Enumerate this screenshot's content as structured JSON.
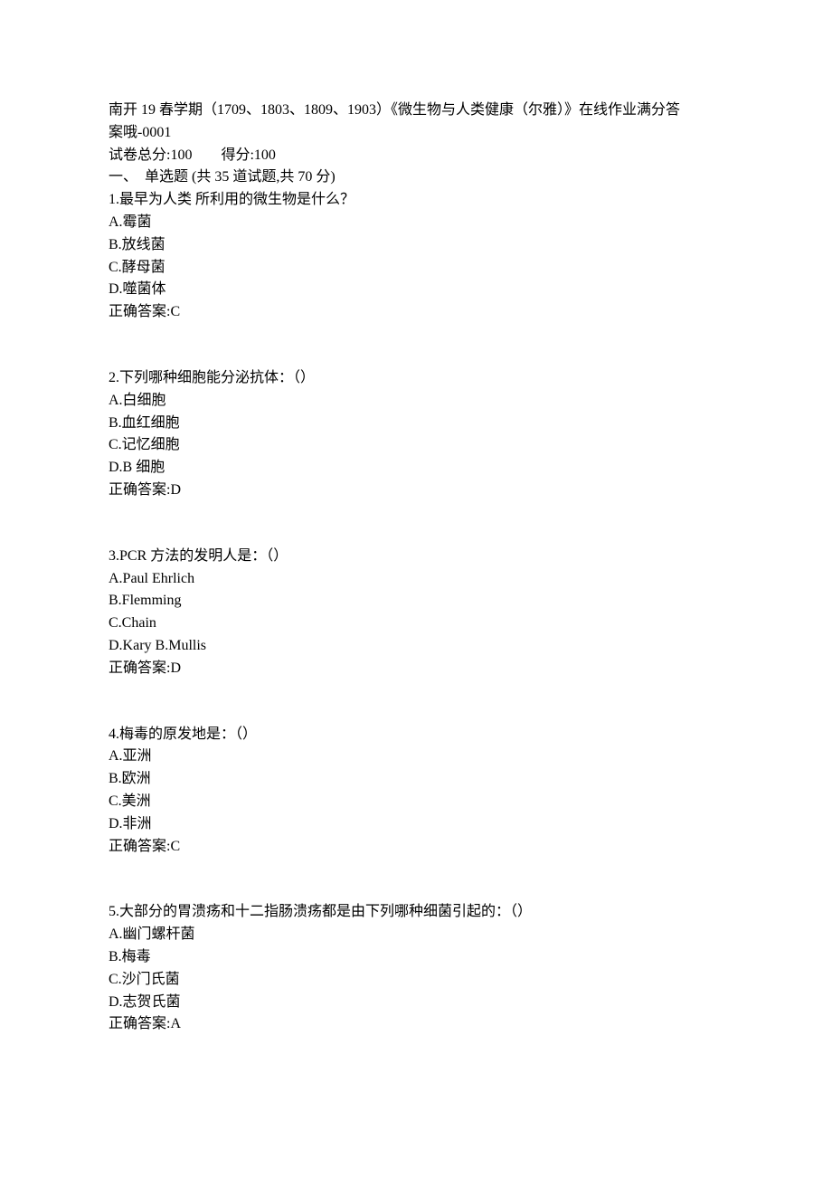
{
  "header": {
    "title_line1": "南开 19 春学期（1709、1803、1809、1903）《微生物与人类健康（尔雅）》在线作业满分答",
    "title_line2": "案哦-0001",
    "score_line": "试卷总分:100        得分:100",
    "section_line": "一、  单选题 (共 35 道试题,共 70 分)"
  },
  "questions": [
    {
      "stem": "1.最早为人类 所利用的微生物是什么？",
      "options": [
        "A.霉菌",
        "B.放线菌",
        "C.酵母菌",
        "D.噬菌体"
      ],
      "answer": "正确答案:C"
    },
    {
      "stem": "2.下列哪种细胞能分泌抗体：（）",
      "options": [
        "A.白细胞",
        "B.血红细胞",
        "C.记忆细胞",
        "D.B 细胞"
      ],
      "answer": "正确答案:D"
    },
    {
      "stem": "3.PCR 方法的发明人是：（）",
      "options": [
        "A.Paul Ehrlich",
        "B.Flemming",
        "C.Chain",
        "D.Kary B.Mullis"
      ],
      "answer": "正确答案:D"
    },
    {
      "stem": "4.梅毒的原发地是：（）",
      "options": [
        "A.亚洲",
        "B.欧洲",
        "C.美洲",
        "D.非洲"
      ],
      "answer": "正确答案:C"
    },
    {
      "stem": "5.大部分的胃溃疡和十二指肠溃疡都是由下列哪种细菌引起的：（）",
      "options": [
        "A.幽门螺杆菌",
        "B.梅毒",
        "C.沙门氏菌",
        "D.志贺氏菌"
      ],
      "answer": "正确答案:A"
    }
  ]
}
